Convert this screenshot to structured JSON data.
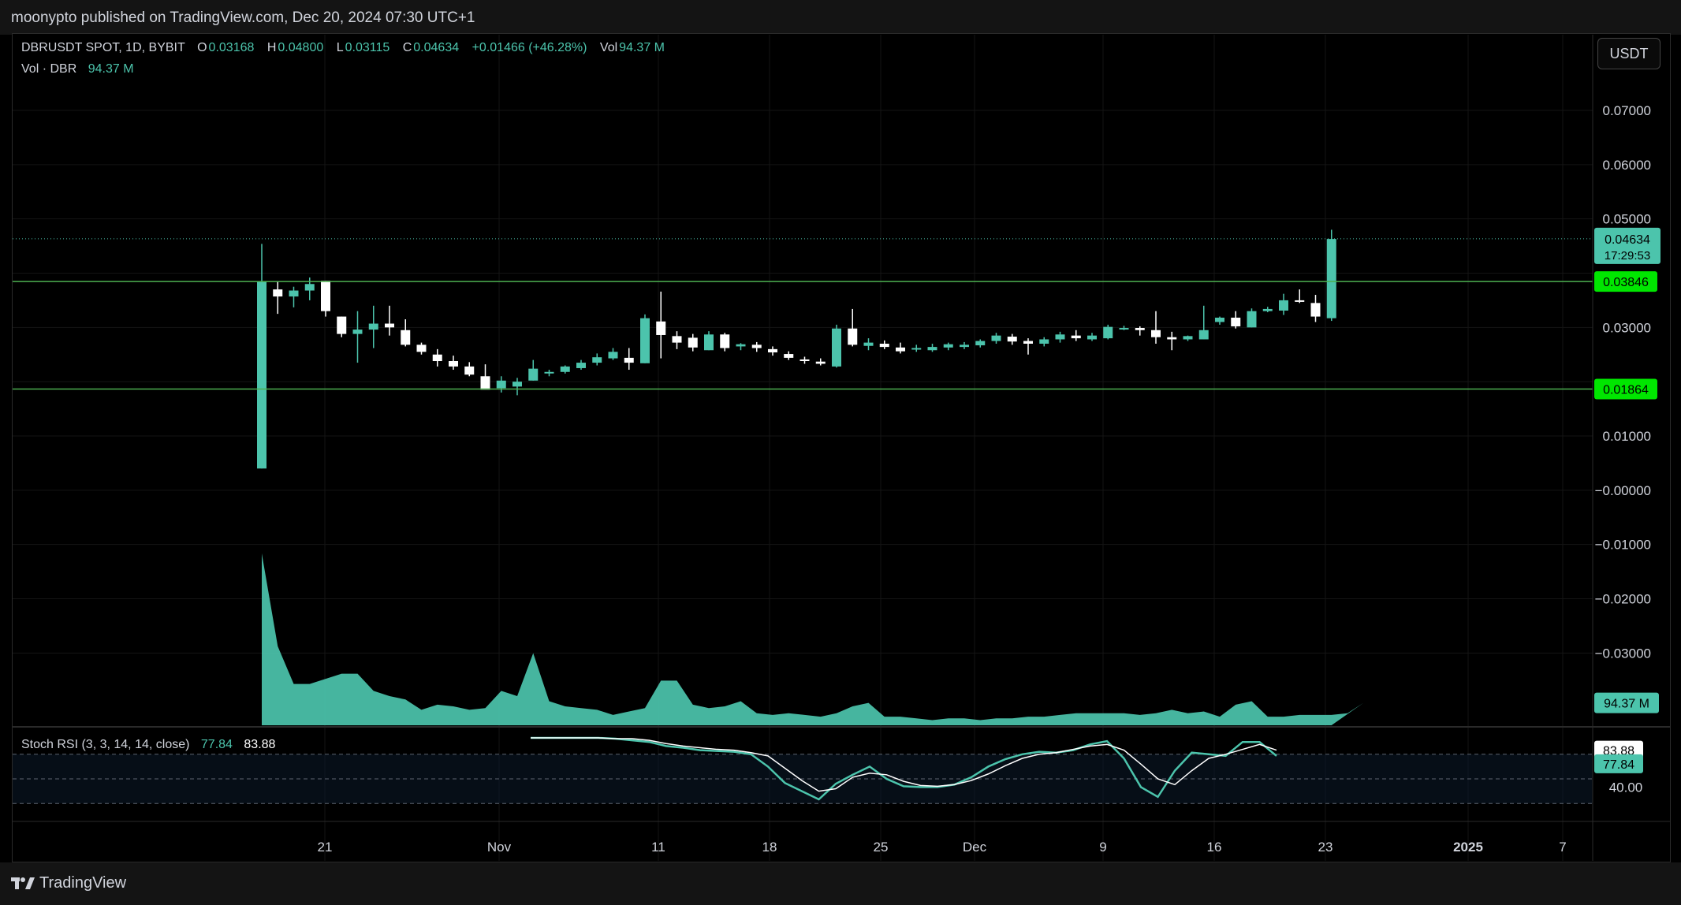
{
  "header": {
    "published": "moonypto published on TradingView.com, Dec 20, 2024 07:30 UTC+1"
  },
  "legend": {
    "symbol": "DBRUSDT SPOT, 1D, BYBIT",
    "o_label": "O",
    "o": "0.03168",
    "h_label": "H",
    "h": "0.04800",
    "l_label": "L",
    "l": "0.03115",
    "c_label": "C",
    "c": "0.04634",
    "change": "+0.01466 (+46.28%)",
    "vol_label": "Vol",
    "vol": "94.37 M",
    "vol_series": "Vol · DBR",
    "vol_series_value": "94.37 M"
  },
  "stoch": {
    "label": "Stoch RSI (3, 3, 14, 14, close)",
    "k": "77.84",
    "d": "83.88"
  },
  "currency_button": "USDT",
  "brand": "TradingView",
  "colors": {
    "up": "#4cc4ac",
    "down": "#ffffff",
    "level": "#4caf50",
    "label_green": "#00e600",
    "bg": "#000000"
  },
  "chart_data": {
    "type": "candlestick",
    "price_axis": {
      "min": -0.04,
      "max": 0.075,
      "ticks": [
        "0.07000",
        "0.06000",
        "0.05000",
        "0.03000",
        "0.01000",
        "−0.00000",
        "−0.01000",
        "−0.02000",
        "−0.03000"
      ]
    },
    "x_axis_labels": [
      "21",
      "Nov",
      "11",
      "18",
      "25",
      "Dec",
      "9",
      "16",
      "23",
      "2025",
      "7"
    ],
    "levels": [
      {
        "value": 0.03846,
        "label": "0.03846"
      },
      {
        "value": 0.01864,
        "label": "0.01864"
      }
    ],
    "last_price": {
      "value": 0.04634,
      "label": "0.04634",
      "countdown": "17:29:53"
    },
    "volume_label": "94.37 M",
    "candles": [
      [
        0.004,
        0.0454,
        0.004,
        0.0385
      ],
      [
        0.037,
        0.0385,
        0.0325,
        0.0357
      ],
      [
        0.0357,
        0.0375,
        0.0337,
        0.0368
      ],
      [
        0.0368,
        0.0392,
        0.035,
        0.038
      ],
      [
        0.0386,
        0.0386,
        0.032,
        0.033
      ],
      [
        0.032,
        0.032,
        0.0282,
        0.0288
      ],
      [
        0.0288,
        0.033,
        0.0235,
        0.0296
      ],
      [
        0.0296,
        0.034,
        0.0262,
        0.0307
      ],
      [
        0.0307,
        0.034,
        0.0285,
        0.03
      ],
      [
        0.0295,
        0.0315,
        0.0265,
        0.0268
      ],
      [
        0.0268,
        0.0272,
        0.025,
        0.0255
      ],
      [
        0.025,
        0.026,
        0.0228,
        0.0238
      ],
      [
        0.0238,
        0.0248,
        0.0222,
        0.0228
      ],
      [
        0.0228,
        0.0236,
        0.021,
        0.0213
      ],
      [
        0.021,
        0.0232,
        0.0185,
        0.0185
      ],
      [
        0.0188,
        0.021,
        0.018,
        0.0202
      ],
      [
        0.0191,
        0.0207,
        0.0175,
        0.02
      ],
      [
        0.0202,
        0.024,
        0.0202,
        0.0224
      ],
      [
        0.0217,
        0.0222,
        0.021,
        0.0218
      ],
      [
        0.0218,
        0.023,
        0.0215,
        0.0228
      ],
      [
        0.0225,
        0.024,
        0.0222,
        0.0235
      ],
      [
        0.0235,
        0.0252,
        0.023,
        0.0245
      ],
      [
        0.0243,
        0.0262,
        0.024,
        0.0255
      ],
      [
        0.0244,
        0.0262,
        0.0222,
        0.0235
      ],
      [
        0.0234,
        0.0324,
        0.0234,
        0.0317
      ],
      [
        0.0311,
        0.0366,
        0.0243,
        0.0286
      ],
      [
        0.0284,
        0.0293,
        0.026,
        0.0272
      ],
      [
        0.0281,
        0.0288,
        0.0256,
        0.0263
      ],
      [
        0.0258,
        0.0293,
        0.0258,
        0.0287
      ],
      [
        0.0287,
        0.029,
        0.0256,
        0.0262
      ],
      [
        0.0265,
        0.0271,
        0.0258,
        0.0269
      ],
      [
        0.0268,
        0.0273,
        0.0255,
        0.0262
      ],
      [
        0.026,
        0.0265,
        0.0248,
        0.0254
      ],
      [
        0.0251,
        0.0256,
        0.024,
        0.0244
      ],
      [
        0.0241,
        0.0246,
        0.0233,
        0.0238
      ],
      [
        0.0237,
        0.0243,
        0.023,
        0.0233
      ],
      [
        0.0228,
        0.0305,
        0.0226,
        0.0298
      ],
      [
        0.0298,
        0.0334,
        0.0265,
        0.0268
      ],
      [
        0.0266,
        0.028,
        0.0258,
        0.0272
      ],
      [
        0.027,
        0.0276,
        0.026,
        0.0264
      ],
      [
        0.0263,
        0.0272,
        0.0252,
        0.0256
      ],
      [
        0.026,
        0.0268,
        0.0255,
        0.0262
      ],
      [
        0.0258,
        0.027,
        0.0255,
        0.0264
      ],
      [
        0.0263,
        0.0272,
        0.0258,
        0.0269
      ],
      [
        0.0264,
        0.0273,
        0.026,
        0.0268
      ],
      [
        0.0267,
        0.0278,
        0.0263,
        0.0275
      ],
      [
        0.0275,
        0.029,
        0.027,
        0.0285
      ],
      [
        0.0283,
        0.0288,
        0.0268,
        0.0274
      ],
      [
        0.0275,
        0.028,
        0.025,
        0.027
      ],
      [
        0.027,
        0.0282,
        0.0265,
        0.0278
      ],
      [
        0.0278,
        0.0292,
        0.0272,
        0.0287
      ],
      [
        0.0285,
        0.0295,
        0.0275,
        0.028
      ],
      [
        0.0278,
        0.029,
        0.0275,
        0.0285
      ],
      [
        0.028,
        0.0305,
        0.0278,
        0.0301
      ],
      [
        0.0297,
        0.0303,
        0.0295,
        0.0299
      ],
      [
        0.0299,
        0.0302,
        0.0285,
        0.0295
      ],
      [
        0.0295,
        0.033,
        0.027,
        0.0282
      ],
      [
        0.0282,
        0.0292,
        0.0258,
        0.0278
      ],
      [
        0.0278,
        0.0285,
        0.0275,
        0.0284
      ],
      [
        0.0278,
        0.034,
        0.0278,
        0.0295
      ],
      [
        0.031,
        0.032,
        0.0305,
        0.0318
      ],
      [
        0.0318,
        0.033,
        0.0298,
        0.0302
      ],
      [
        0.03,
        0.0335,
        0.03,
        0.033
      ],
      [
        0.033,
        0.0338,
        0.0328,
        0.0334
      ],
      [
        0.0331,
        0.0362,
        0.0323,
        0.035
      ],
      [
        0.035,
        0.037,
        0.0345,
        0.0348
      ],
      [
        0.0345,
        0.036,
        0.031,
        0.032
      ],
      [
        0.0317,
        0.048,
        0.0312,
        0.0463
      ]
    ],
    "volume": [
      1.0,
      0.46,
      0.24,
      0.24,
      0.27,
      0.3,
      0.3,
      0.2,
      0.17,
      0.15,
      0.09,
      0.12,
      0.11,
      0.09,
      0.1,
      0.2,
      0.17,
      0.42,
      0.14,
      0.11,
      0.1,
      0.09,
      0.06,
      0.08,
      0.1,
      0.26,
      0.26,
      0.12,
      0.1,
      0.11,
      0.14,
      0.07,
      0.06,
      0.07,
      0.06,
      0.05,
      0.07,
      0.11,
      0.13,
      0.05,
      0.05,
      0.04,
      0.03,
      0.04,
      0.04,
      0.03,
      0.04,
      0.04,
      0.05,
      0.05,
      0.06,
      0.07,
      0.07,
      0.07,
      0.07,
      0.06,
      0.07,
      0.09,
      0.07,
      0.08,
      0.05,
      0.12,
      0.14,
      0.05,
      0.05,
      0.06,
      0.06,
      0.06,
      0.07,
      0.13
    ],
    "stoch_axis": {
      "ticks": [
        "40.00"
      ],
      "upper_band": 80,
      "lower_band": 20
    },
    "stoch_k": [
      100,
      100,
      100,
      100,
      100,
      99,
      97,
      95,
      90,
      88,
      85,
      84,
      83,
      80,
      65,
      45,
      35,
      25,
      44,
      55,
      65,
      50,
      41,
      40,
      40,
      43,
      52,
      65,
      74,
      80,
      83,
      82,
      85,
      92,
      96,
      75,
      40,
      28,
      60,
      82,
      80,
      78,
      95,
      95,
      78
    ],
    "stoch_d": [
      100,
      100,
      100,
      100,
      100,
      99,
      99,
      97,
      93,
      90,
      88,
      86,
      85,
      82,
      78,
      63,
      48,
      35,
      38,
      52,
      57,
      55,
      47,
      42,
      41,
      43,
      48,
      56,
      66,
      75,
      80,
      82,
      86,
      90,
      92,
      85,
      68,
      50,
      43,
      60,
      75,
      80,
      86,
      92,
      85
    ]
  }
}
